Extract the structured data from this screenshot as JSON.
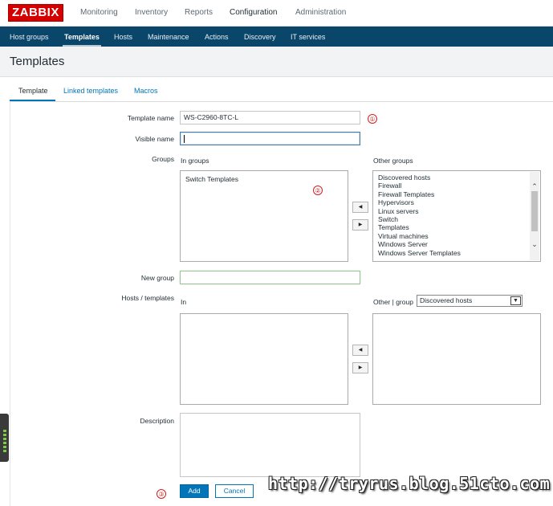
{
  "app": {
    "logo": "ZABBIX",
    "top_nav": [
      "Monitoring",
      "Inventory",
      "Reports",
      "Configuration",
      "Administration"
    ],
    "top_nav_active": "Configuration",
    "sub_nav": [
      "Host groups",
      "Templates",
      "Hosts",
      "Maintenance",
      "Actions",
      "Discovery",
      "IT services"
    ],
    "sub_nav_active": "Templates",
    "accent_color": "#0275b8",
    "header_color": "#0a466a",
    "logo_color": "#d40000"
  },
  "page": {
    "title": "Templates"
  },
  "tabs": [
    "Template",
    "Linked templates",
    "Macros"
  ],
  "tab_active": "Template",
  "form": {
    "template_name_label": "Template name",
    "template_name_value": "WS-C2960-8TC-L",
    "visible_name_label": "Visible name",
    "visible_name_value": "",
    "groups_label": "Groups",
    "in_groups_caption": "In groups",
    "in_groups": [
      "Switch Templates"
    ],
    "other_groups_caption": "Other groups",
    "other_groups": [
      "Discovered hosts",
      "Firewall",
      "Firewall Templates",
      "Hypervisors",
      "Linux servers",
      "Switch",
      "Templates",
      "Virtual machines",
      "Windows Server",
      "Windows Server Templates"
    ],
    "new_group_label": "New group",
    "new_group_value": "",
    "hosts_templates_label": "Hosts / templates",
    "in_caption": "In",
    "other_group_caption": "Other | group",
    "other_group_selected": "Discovered hosts",
    "description_label": "Description",
    "description_value": "",
    "add_button": "Add",
    "cancel_button": "Cancel"
  },
  "move_buttons": {
    "left": "◀",
    "right": "▶"
  },
  "annotations": [
    "①",
    "②",
    "③"
  ],
  "watermark": "http://tryrus.blog.51cto.com"
}
